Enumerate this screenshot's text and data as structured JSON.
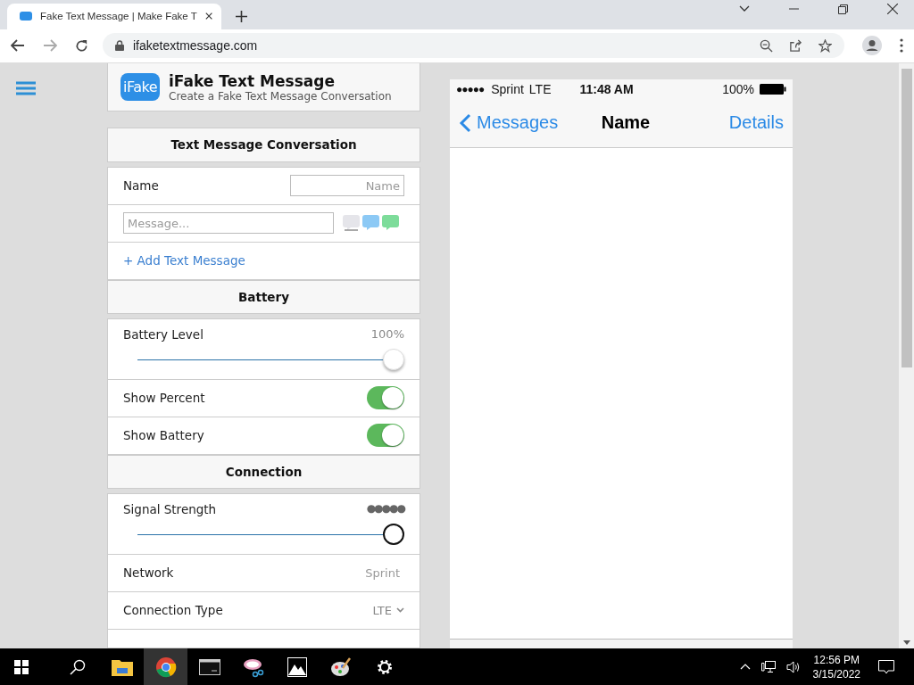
{
  "browser": {
    "tab": {
      "title": "Fake Text Message | Make Fake T"
    },
    "url": "ifaketextmessage.com"
  },
  "site": {
    "logo": "iFake",
    "title": "iFake Text Message",
    "subtitle": "Create a Fake Text Message Conversation"
  },
  "conversation": {
    "heading": "Text Message Conversation",
    "name_label": "Name",
    "name_placeholder": "Name",
    "message_placeholder": "Message...",
    "bubbles": [
      {
        "color": "#e5e5ea",
        "selected": true
      },
      {
        "color": "#8cc9f5",
        "selected": false
      },
      {
        "color": "#7ddc9a",
        "selected": false
      }
    ],
    "add_link": "+ Add Text Message"
  },
  "battery": {
    "heading": "Battery",
    "level_label": "Battery Level",
    "reading": "100%",
    "level": 1,
    "toggles": [
      {
        "label": "Show Percent",
        "on": true
      },
      {
        "label": "Show Battery",
        "on": true
      }
    ]
  },
  "connection": {
    "heading": "Connection",
    "signal_label": "Signal Strength",
    "signal_reading": "●●●●●",
    "level": 1,
    "network_label": "Network",
    "network_placeholder": "Sprint",
    "type_label": "Connection Type",
    "type_value": "LTE"
  },
  "phone": {
    "signal": "●●●●●",
    "carrier": "Sprint",
    "network": "LTE",
    "time": "11:48 AM",
    "battery": "100%",
    "back": "Messages",
    "title": "Name",
    "details": "Details"
  },
  "taskbar": {
    "apps": [
      {
        "kind": "explorer",
        "selected": false
      },
      {
        "kind": "chrome",
        "selected": true
      },
      {
        "kind": "terminal",
        "selected": false
      },
      {
        "kind": "snip",
        "selected": false
      },
      {
        "kind": "photos",
        "selected": false
      },
      {
        "kind": "paint",
        "selected": false
      },
      {
        "kind": "settings",
        "selected": false
      }
    ],
    "time": "12:56 PM",
    "date": "3/15/2022"
  }
}
